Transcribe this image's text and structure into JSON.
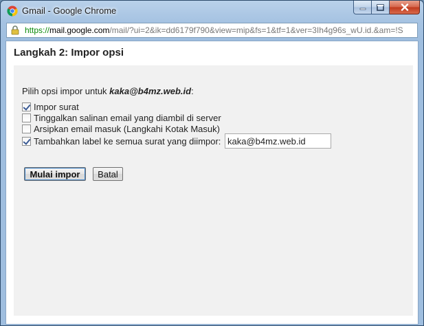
{
  "window": {
    "title": "Gmail - Google Chrome"
  },
  "address_bar": {
    "scheme": "https://",
    "host": "mail.google.com",
    "path": "/mail/?ui=2&ik=dd6179f790&view=mip&fs=1&tf=1&ver=3Ih4g96s_wU.id.&am=!S"
  },
  "page": {
    "title": "Langkah 2: Impor opsi",
    "intro_prefix": "Pilih opsi impor untuk ",
    "intro_account": "kaka@b4mz.web.id",
    "intro_suffix": ":",
    "options": [
      {
        "label": "Impor surat",
        "checked": true
      },
      {
        "label": "Tinggalkan salinan email yang diambil di server",
        "checked": false
      },
      {
        "label": "Arsipkan email masuk (Langkahi Kotak Masuk)",
        "checked": false
      },
      {
        "label": "Tambahkan label ke semua surat yang diimpor:",
        "checked": true
      }
    ],
    "label_input_value": "kaka@b4mz.web.id",
    "start_button": "Mulai impor",
    "cancel_button": "Batal"
  },
  "colors": {
    "url_scheme": "#0a8a0a",
    "panel_bg": "#f1f1f1"
  },
  "icons": {
    "app": "chrome-logo-icon",
    "secure": "lock-icon",
    "minimize": "minimize-icon",
    "maximize": "maximize-icon",
    "close": "close-icon"
  }
}
